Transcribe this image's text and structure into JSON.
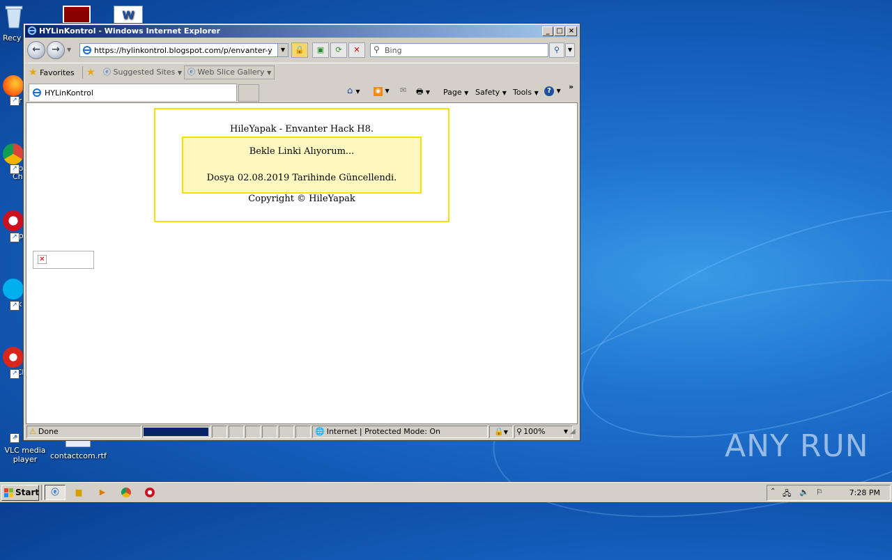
{
  "desktop": {
    "icons": [
      {
        "label": "Recy",
        "kind": "recycle-bin"
      },
      {
        "label": "Fir",
        "kind": "firefox"
      },
      {
        "label": "Go Chr",
        "kind": "chrome"
      },
      {
        "label": "Op",
        "kind": "opera"
      },
      {
        "label": "Sk",
        "kind": "skype"
      },
      {
        "label": "CCl",
        "kind": "ccleaner"
      },
      {
        "label": "VLC media player",
        "kind": "vlc"
      },
      {
        "label": "contactcom.rtf",
        "kind": "rtf-file"
      }
    ],
    "watermark": "ANY RUN"
  },
  "window": {
    "title": "HYLinKontrol - Windows Internet Explorer",
    "address": "https://hylinkontrol.blogspot.com/p/envanter-yenisi.h",
    "search_placeholder": "Bing",
    "favorites": {
      "favorites_label": "Favorites",
      "suggested_sites": "Suggested Sites",
      "web_slice_gallery": "Web Slice Gallery"
    },
    "tab_title": "HYLinKontrol",
    "commands": {
      "page": "Page",
      "safety": "Safety",
      "tools": "Tools"
    },
    "status": {
      "text": "Done",
      "progress": 1.0,
      "zone": "Internet | Protected Mode: On",
      "zoom": "100%"
    }
  },
  "page": {
    "heading": "HileYapak - Envanter Hack H8.",
    "wait_text": "Bekle Linki Alıyorum...",
    "updated_text": "Dosya 02.08.2019 Tarihinde Güncellendi.",
    "copyright": "Copyright © HileYapak"
  },
  "taskbar": {
    "start_label": "Start",
    "clock": "7:28 PM"
  },
  "colors": {
    "box_border": "#f5e000",
    "inner_box_fill": "#fff8c0",
    "title_gradient_start": "#0a246a",
    "progress_fill": "#0a246a"
  }
}
